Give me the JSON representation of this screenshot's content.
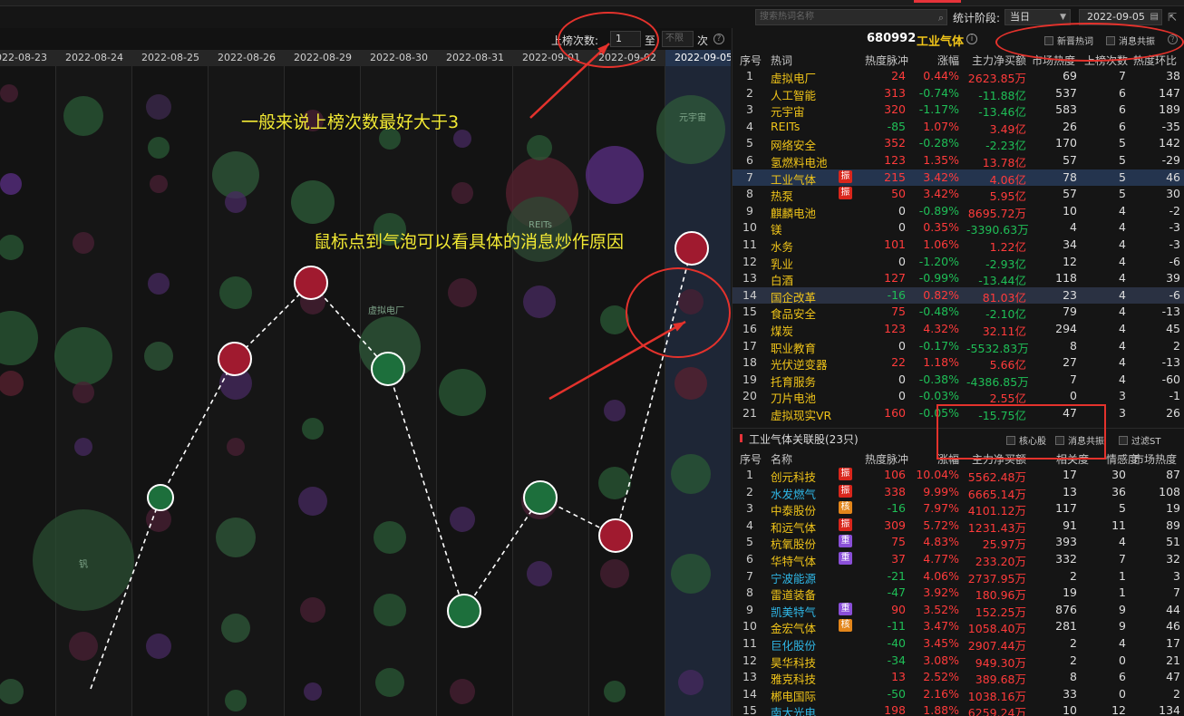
{
  "toolbar": {
    "search_placeholder": "搜索热词名称",
    "stat_label": "统计阶段:",
    "stat_value": "当日",
    "date_value": "2022-09-05"
  },
  "filter": {
    "label": "上榜次数:",
    "from_value": "1",
    "to_text": "至",
    "to_placeholder": "不限",
    "times_text": "次",
    "help": "?"
  },
  "dates": [
    "2022-08-23",
    "2022-08-24",
    "2022-08-25",
    "2022-08-26",
    "2022-08-29",
    "2022-08-30",
    "2022-08-31",
    "2022-09-01",
    "2022-09-02",
    "2022-09-05"
  ],
  "bubble_labels": [
    "元宇宙",
    "REITs",
    "虚拟电厂",
    "钒"
  ],
  "annotations": {
    "tip1": "一般来说上榜次数最好大于3",
    "tip2": "鼠标点到气泡可以看具体的消息炒作原因"
  },
  "header": {
    "code": "680992",
    "name": "工业气体",
    "info": "i",
    "check_new": "新晋热词",
    "check_news": "消息共振",
    "help": "?"
  },
  "hot_columns": [
    "序号",
    "热词",
    "热度脉冲",
    "涨幅",
    "主力净买额",
    "市场热度",
    "上榜次数",
    "热度环比"
  ],
  "hot_rows": [
    {
      "no": "1",
      "name": "虚拟电厂",
      "badge": "",
      "pulse": "24",
      "pct": "0.44%",
      "amt": "2623.85万",
      "heat": "69",
      "cnt": "7",
      "chg": "38"
    },
    {
      "no": "2",
      "name": "人工智能",
      "badge": "",
      "pulse": "313",
      "pct": "-0.74%",
      "amt": "-11.88亿",
      "heat": "537",
      "cnt": "6",
      "chg": "147"
    },
    {
      "no": "3",
      "name": "元宇宙",
      "badge": "",
      "pulse": "320",
      "pct": "-1.17%",
      "amt": "-13.46亿",
      "heat": "583",
      "cnt": "6",
      "chg": "189"
    },
    {
      "no": "4",
      "name": "REITs",
      "badge": "",
      "pulse": "-85",
      "pct": "1.07%",
      "amt": "3.49亿",
      "heat": "26",
      "cnt": "6",
      "chg": "-35"
    },
    {
      "no": "5",
      "name": "网络安全",
      "badge": "",
      "pulse": "352",
      "pct": "-0.28%",
      "amt": "-2.23亿",
      "heat": "170",
      "cnt": "5",
      "chg": "142"
    },
    {
      "no": "6",
      "name": "氢燃料电池",
      "badge": "",
      "pulse": "123",
      "pct": "1.35%",
      "amt": "13.78亿",
      "heat": "57",
      "cnt": "5",
      "chg": "-29"
    },
    {
      "no": "7",
      "name": "工业气体",
      "badge": "振",
      "pulse": "215",
      "pct": "3.42%",
      "amt": "4.06亿",
      "heat": "78",
      "cnt": "5",
      "chg": "46"
    },
    {
      "no": "8",
      "name": "热泵",
      "badge": "振",
      "pulse": "50",
      "pct": "3.42%",
      "amt": "5.95亿",
      "heat": "57",
      "cnt": "5",
      "chg": "30"
    },
    {
      "no": "9",
      "name": "麒麟电池",
      "badge": "",
      "pulse": "0",
      "pct": "-0.89%",
      "amt": "8695.72万",
      "heat": "10",
      "cnt": "4",
      "chg": "-2"
    },
    {
      "no": "10",
      "name": "镁",
      "badge": "",
      "pulse": "0",
      "pct": "0.35%",
      "amt": "-3390.63万",
      "heat": "4",
      "cnt": "4",
      "chg": "-3"
    },
    {
      "no": "11",
      "name": "水务",
      "badge": "",
      "pulse": "101",
      "pct": "1.06%",
      "amt": "1.22亿",
      "heat": "34",
      "cnt": "4",
      "chg": "-3"
    },
    {
      "no": "12",
      "name": "乳业",
      "badge": "",
      "pulse": "0",
      "pct": "-1.20%",
      "amt": "-2.93亿",
      "heat": "12",
      "cnt": "4",
      "chg": "-6"
    },
    {
      "no": "13",
      "name": "白酒",
      "badge": "",
      "pulse": "127",
      "pct": "-0.99%",
      "amt": "-13.44亿",
      "heat": "118",
      "cnt": "4",
      "chg": "39"
    },
    {
      "no": "14",
      "name": "国企改革",
      "badge": "",
      "pulse": "-16",
      "pct": "0.82%",
      "amt": "81.03亿",
      "heat": "23",
      "cnt": "4",
      "chg": "-6"
    },
    {
      "no": "15",
      "name": "食品安全",
      "badge": "",
      "pulse": "75",
      "pct": "-0.48%",
      "amt": "-2.10亿",
      "heat": "79",
      "cnt": "4",
      "chg": "-13"
    },
    {
      "no": "16",
      "name": "煤炭",
      "badge": "",
      "pulse": "123",
      "pct": "4.32%",
      "amt": "32.11亿",
      "heat": "294",
      "cnt": "4",
      "chg": "45"
    },
    {
      "no": "17",
      "name": "职业教育",
      "badge": "",
      "pulse": "0",
      "pct": "-0.17%",
      "amt": "-5532.83万",
      "heat": "8",
      "cnt": "4",
      "chg": "2"
    },
    {
      "no": "18",
      "name": "光伏逆变器",
      "badge": "",
      "pulse": "22",
      "pct": "1.18%",
      "amt": "5.66亿",
      "heat": "27",
      "cnt": "4",
      "chg": "-13"
    },
    {
      "no": "19",
      "name": "托育服务",
      "badge": "",
      "pulse": "0",
      "pct": "-0.38%",
      "amt": "-4386.85万",
      "heat": "7",
      "cnt": "4",
      "chg": "-60"
    },
    {
      "no": "20",
      "name": "刀片电池",
      "badge": "",
      "pulse": "0",
      "pct": "-0.03%",
      "amt": "2.55亿",
      "heat": "0",
      "cnt": "3",
      "chg": "-1"
    },
    {
      "no": "21",
      "name": "虚拟现实VR",
      "badge": "",
      "pulse": "160",
      "pct": "-0.05%",
      "amt": "-15.75亿",
      "heat": "47",
      "cnt": "3",
      "chg": "26"
    }
  ],
  "sub": {
    "title": "工业气体关联股(23只)",
    "check_core": "核心股",
    "check_news": "消息共振",
    "check_st": "过滤ST"
  },
  "stock_columns": [
    "序号",
    "名称",
    "热度脉冲",
    "涨幅",
    "主力净买额",
    "相关度",
    "情感度",
    "市场热度"
  ],
  "stock_rows": [
    {
      "no": "1",
      "name": "创元科技",
      "badge": "振",
      "pulse": "106",
      "pct": "10.04%",
      "amt": "5562.48万",
      "rel": "17",
      "emo": "30",
      "mkt": "87"
    },
    {
      "no": "2",
      "name": "水发燃气",
      "badge": "振",
      "pulse": "338",
      "pct": "9.99%",
      "amt": "6665.14万",
      "rel": "13",
      "emo": "36",
      "mkt": "108"
    },
    {
      "no": "3",
      "name": "中泰股份",
      "badge": "核",
      "pulse": "-16",
      "pct": "7.97%",
      "amt": "4101.12万",
      "rel": "117",
      "emo": "5",
      "mkt": "19"
    },
    {
      "no": "4",
      "name": "和远气体",
      "badge": "振",
      "pulse": "309",
      "pct": "5.72%",
      "amt": "1231.43万",
      "rel": "91",
      "emo": "11",
      "mkt": "89"
    },
    {
      "no": "5",
      "name": "杭氧股份",
      "badge": "重",
      "pulse": "75",
      "pct": "4.83%",
      "amt": "25.97万",
      "rel": "393",
      "emo": "4",
      "mkt": "51"
    },
    {
      "no": "6",
      "name": "华特气体",
      "badge": "重",
      "pulse": "37",
      "pct": "4.77%",
      "amt": "233.20万",
      "rel": "332",
      "emo": "7",
      "mkt": "32"
    },
    {
      "no": "7",
      "name": "宁波能源",
      "badge": "",
      "pulse": "-21",
      "pct": "4.06%",
      "amt": "2737.95万",
      "rel": "2",
      "emo": "1",
      "mkt": "3"
    },
    {
      "no": "8",
      "name": "雷道装备",
      "badge": "",
      "pulse": "-47",
      "pct": "3.92%",
      "amt": "180.96万",
      "rel": "19",
      "emo": "1",
      "mkt": "7"
    },
    {
      "no": "9",
      "name": "凯美特气",
      "badge": "重",
      "pulse": "90",
      "pct": "3.52%",
      "amt": "152.25万",
      "rel": "876",
      "emo": "9",
      "mkt": "44"
    },
    {
      "no": "10",
      "name": "金宏气体",
      "badge": "核",
      "pulse": "-11",
      "pct": "3.47%",
      "amt": "1058.40万",
      "rel": "281",
      "emo": "9",
      "mkt": "46"
    },
    {
      "no": "11",
      "name": "巨化股份",
      "badge": "",
      "pulse": "-40",
      "pct": "3.45%",
      "amt": "2907.44万",
      "rel": "2",
      "emo": "4",
      "mkt": "17"
    },
    {
      "no": "12",
      "name": "昊华科技",
      "badge": "",
      "pulse": "-34",
      "pct": "3.08%",
      "amt": "949.30万",
      "rel": "2",
      "emo": "0",
      "mkt": "21"
    },
    {
      "no": "13",
      "name": "雅克科技",
      "badge": "",
      "pulse": "13",
      "pct": "2.52%",
      "amt": "389.68万",
      "rel": "8",
      "emo": "6",
      "mkt": "47"
    },
    {
      "no": "14",
      "name": "郴电国际",
      "badge": "",
      "pulse": "-50",
      "pct": "2.16%",
      "amt": "1038.16万",
      "rel": "33",
      "emo": "0",
      "mkt": "2"
    },
    {
      "no": "15",
      "name": "南大光电",
      "badge": "",
      "pulse": "198",
      "pct": "1.88%",
      "amt": "6259.24万",
      "rel": "10",
      "emo": "12",
      "mkt": "134"
    }
  ],
  "stock_name_colors": [
    "#f0c419",
    "#2fb7e6",
    "#f0c419",
    "#f0c419",
    "#f0c419",
    "#f0c419",
    "#2fb7e6",
    "#f0c419",
    "#2fb7e6",
    "#f0c419",
    "#2fb7e6",
    "#f0c419",
    "#f0c419",
    "#f0c419",
    "#2fb7e6"
  ],
  "colors": {
    "up": "#ff3b3b",
    "down": "#1fbf57",
    "accent": "#f0c419",
    "annotation": "#e4322c"
  }
}
